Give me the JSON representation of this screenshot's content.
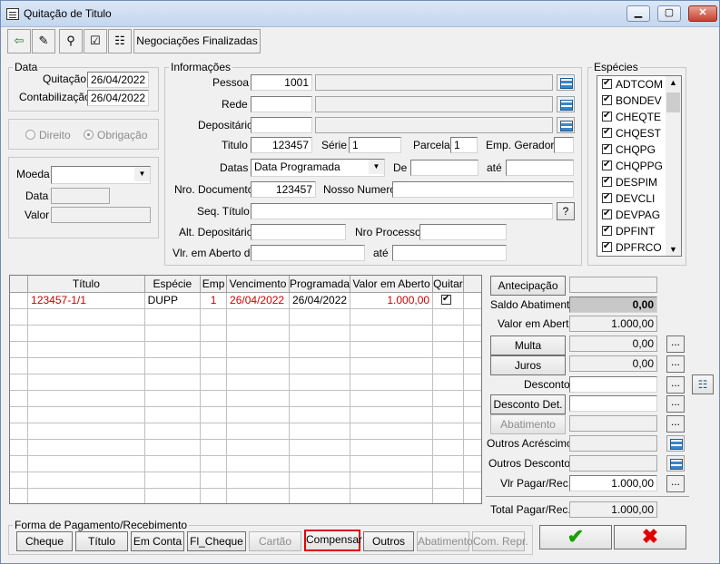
{
  "window": {
    "title": "Quitação de Titulo"
  },
  "toolbar": {
    "negociacoes_label": "Negociações Finalizadas"
  },
  "data_group": {
    "legend": "Data",
    "quitacao_label": "Quitação",
    "quitacao_value": "26/04/2022",
    "contabilizacao_label": "Contabilização",
    "contabilizacao_value": "26/04/2022"
  },
  "direito_group": {
    "direito_label": "Direito",
    "obrigacao_label": "Obrigação"
  },
  "moeda_group": {
    "moeda_label": "Moeda",
    "data_label": "Data",
    "valor_label": "Valor"
  },
  "info": {
    "legend": "Informações",
    "pessoa_label": "Pessoa",
    "pessoa_value": "1001",
    "rede_label": "Rede",
    "depositario_label": "Depositário",
    "titulo_label": "Titulo",
    "titulo_value": "123457",
    "serie_label": "Série",
    "serie_value": "1",
    "parcela_label": "Parcela",
    "parcela_value": "1",
    "emp_geradora_label": "Emp. Geradora",
    "datas_label": "Datas",
    "datas_value": "Data Programada",
    "de_label": "De",
    "ate_label": "até",
    "nro_documento_label": "Nro. Documento",
    "nro_documento_value": "123457",
    "nosso_numero_label": "Nosso Numero",
    "seq_titulo_label": "Seq. Título",
    "seq_btn": "?",
    "alt_depositario_label": "Alt. Depositário",
    "nro_processo_label": "Nro Processo",
    "vlr_aberto_label": "Vlr. em Aberto de",
    "vlr_ate_label": "até"
  },
  "especies": {
    "legend": "Espécies",
    "items": [
      "ADTCOM",
      "BONDEV",
      "CHEQTE",
      "CHQEST",
      "CHQPG",
      "CHQPPG",
      "DESPIM",
      "DEVCLI",
      "DEVPAG",
      "DPFINT",
      "DPFRCO"
    ]
  },
  "grid": {
    "headers": [
      "Título",
      "Espécie",
      "Emp",
      "Vencimento",
      "Programada",
      "Valor em Aberto",
      "Quitar"
    ],
    "row": {
      "titulo": "123457-1/1",
      "especie": "DUPP",
      "emp": "1",
      "vencimento": "26/04/2022",
      "programada": "26/04/2022",
      "valor": "1.000,00"
    }
  },
  "right_panel": {
    "antecipacao_label": "Antecipação",
    "saldo_abatimento_label": "Saldo Abatimento",
    "saldo_abatimento_value": "0,00",
    "valor_aberto_label": "Valor em Aberto",
    "valor_aberto_value": "1.000,00",
    "multa_label": "Multa",
    "multa_value": "0,00",
    "juros_label": "Juros",
    "juros_value": "0,00",
    "desconto_label": "Desconto",
    "desconto_det_label": "Desconto Det.",
    "abatimento_label": "Abatimento",
    "outros_acrescimos_label": "Outros Acréscimos",
    "outros_descontos_label": "Outros Descontos",
    "vlr_pagar_label": "Vlr Pagar/Rec.",
    "vlr_pagar_value": "1.000,00",
    "total_pagar_label": "Total Pagar/Rec.",
    "total_pagar_value": "1.000,00",
    "dots": "..."
  },
  "payment": {
    "legend": "Forma de Pagamento/Recebimento",
    "buttons": [
      "Cheque",
      "Título",
      "Em Conta",
      "Fl_Cheque",
      "Cartão",
      "Compensar",
      "Outros",
      "Abatimento",
      "Com. Repr."
    ]
  },
  "colors": {
    "ok": "#17a000",
    "cancel": "#e00000",
    "highlight": "#e00000"
  }
}
